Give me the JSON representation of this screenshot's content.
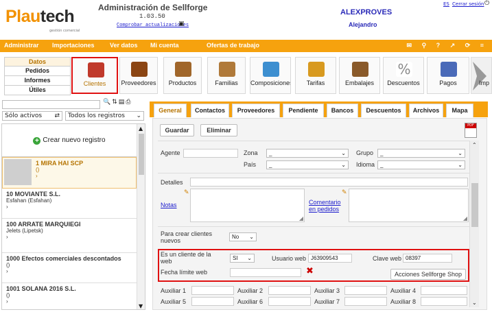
{
  "header": {
    "logo_p": "Plau",
    "logo_r": "tech",
    "logo_sub": "gestión comercial",
    "app_title": "Administración de Sellforge",
    "version": "1.03.50",
    "check_updates": "Comprobar actualizaciones",
    "company": "ALEXPROVES",
    "user": "Alejandro",
    "lang": "ES",
    "logout": "Cerrar sesión"
  },
  "menubar": {
    "items": [
      "Administrar",
      "Importaciones",
      "Ver datos",
      "Mi cuenta",
      "Ofertas de trabajo"
    ],
    "icons": "✉ ⚲ ? ↗ ⟳ ≡"
  },
  "leftnav": {
    "items": [
      "Datos",
      "Pedidos",
      "Informes",
      "Útiles"
    ]
  },
  "modules": [
    {
      "label": "Clientes",
      "color": "#c0392b"
    },
    {
      "label": "Proveedores",
      "color": "#8b4513"
    },
    {
      "label": "Productos",
      "color": "#a0662a"
    },
    {
      "label": "Familias",
      "color": "#b07a3a"
    },
    {
      "label": "Composiciones",
      "color": "#3d8fd0"
    },
    {
      "label": "Tarifas",
      "color": "#d89a20"
    },
    {
      "label": "Embalajes",
      "color": "#8a5a2a"
    },
    {
      "label": "Descuentos",
      "color": "#999999"
    },
    {
      "label": "Pagos",
      "color": "#4a6ab8"
    },
    {
      "label": "Imp",
      "color": "#888888"
    }
  ],
  "leftpanel": {
    "filter_active": "Sólo activos",
    "filter_registers": "Todos los registros",
    "new_register": "Crear nuevo registro",
    "items": [
      {
        "name": "1 MIRA HAI SCP",
        "sub1": "()",
        "sub2": "›"
      },
      {
        "name": "10 MOVIANTE S.L.",
        "sub1": "Esfahan (Esfahan)",
        "sub2": "›"
      },
      {
        "name": "100 ARRATE MARQUIEGI",
        "sub1": "Jelets (Lipetsk)",
        "sub2": "›"
      },
      {
        "name": "1000 Efectos comerciales descontados",
        "sub1": "()",
        "sub2": "›"
      },
      {
        "name": "1001 SOLANA 2016 S.L.",
        "sub1": "()",
        "sub2": "›"
      }
    ]
  },
  "tabs": [
    "General",
    "Contactos",
    "Proveedores",
    "Pendiente",
    "Bancos",
    "Descuentos",
    "Archivos",
    "Mapa"
  ],
  "form": {
    "save": "Guardar",
    "delete": "Eliminar",
    "pdf": "PDF",
    "agente": "Agente",
    "zona": "Zona",
    "zona_val": "_",
    "grupo": "Grupo",
    "grupo_val": "_",
    "pais": "País",
    "pais_val": "_",
    "idioma": "Idioma",
    "idioma_val": "_",
    "detalles": "Detalles",
    "notas": "Notas",
    "comentario": "Comentario en pedidos",
    "crear_clientes": "Para crear clientes nuevos",
    "crear_val": "No",
    "es_cliente_web": "Es un cliente de la web",
    "es_cliente_val": "SI",
    "usuario_web": "Usuario web",
    "usuario_val": "J63909543",
    "clave_web": "Clave web",
    "clave_val": "08397",
    "fecha_limite": "Fecha límite web",
    "acciones": "Acciones Sellforge Shop",
    "aux": [
      "Auxiliar 1",
      "Auxiliar 2",
      "Auxiliar 3",
      "Auxiliar 4",
      "Auxiliar 5",
      "Auxiliar 6",
      "Auxiliar 7",
      "Auxiliar 8"
    ]
  }
}
